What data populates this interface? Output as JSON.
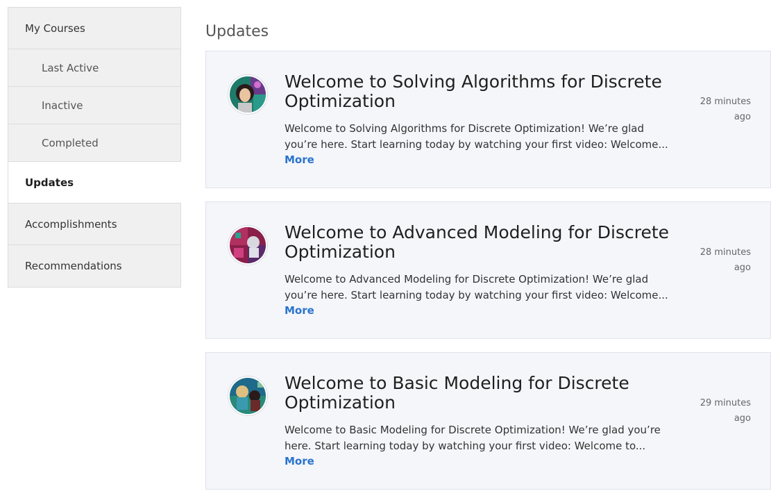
{
  "sidebar": {
    "items": [
      {
        "label": "My Courses"
      },
      {
        "label": "Last Active"
      },
      {
        "label": "Inactive"
      },
      {
        "label": "Completed"
      },
      {
        "label": "Updates"
      },
      {
        "label": "Accomplishments"
      },
      {
        "label": "Recommendations"
      }
    ]
  },
  "main": {
    "title": "Updates",
    "updates": [
      {
        "title": "Welcome to Solving Algorithms for Discrete Optimization",
        "body": "Welcome to Solving Algorithms for Discrete Optimization! We’re glad you’re here. Start learning today by watching your first video: Welcome...",
        "more": "More",
        "time_line1": "28 minutes",
        "time_line2": "ago"
      },
      {
        "title": "Welcome to Advanced Modeling for Discrete Optimization",
        "body": "Welcome to Advanced Modeling for Discrete Optimization! We’re glad you’re here. Start learning today by watching your first video: Welcome...",
        "more": "More",
        "time_line1": "28 minutes",
        "time_line2": "ago"
      },
      {
        "title": "Welcome to Basic Modeling for Discrete Optimization",
        "body": "Welcome to Basic Modeling for Discrete Optimization! We’re glad you’re here. Start learning today by watching your first video: Welcome to...",
        "more": "More",
        "time_line1": "29 minutes",
        "time_line2": "ago"
      }
    ]
  },
  "colors": {
    "link": "#2a73cc",
    "card_bg": "#f4f6fa",
    "sidebar_bg": "#f0f0f0"
  }
}
